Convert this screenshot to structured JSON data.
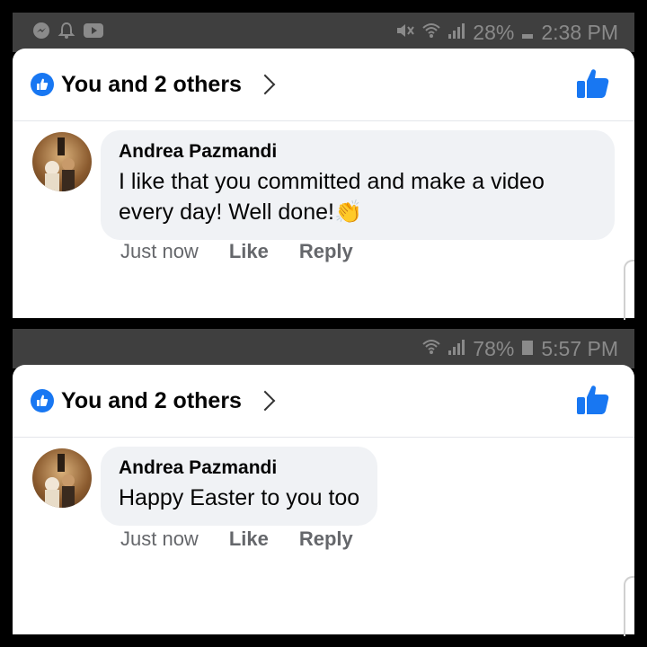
{
  "panels": [
    {
      "status_bar": {
        "battery_percent": "28%",
        "time": "2:38 PM"
      },
      "header": {
        "reactions_text": "You and 2 others"
      },
      "comment": {
        "author": "Andrea Pazmandi",
        "text": "I like that you committed and make a video every day!   Well done!",
        "emoji": "👏",
        "time": "Just now",
        "like_label": "Like",
        "reply_label": "Reply"
      }
    },
    {
      "status_bar": {
        "battery_percent": "78%",
        "time": "5:57 PM"
      },
      "header": {
        "reactions_text": "You and 2 others"
      },
      "comment": {
        "author": "Andrea Pazmandi",
        "text": "Happy Easter to you too",
        "time": "Just now",
        "like_label": "Like",
        "reply_label": "Reply"
      }
    }
  ],
  "colors": {
    "accent": "#1877f2",
    "bubble": "#f0f2f5",
    "status_bar": "#3f3f3f"
  }
}
